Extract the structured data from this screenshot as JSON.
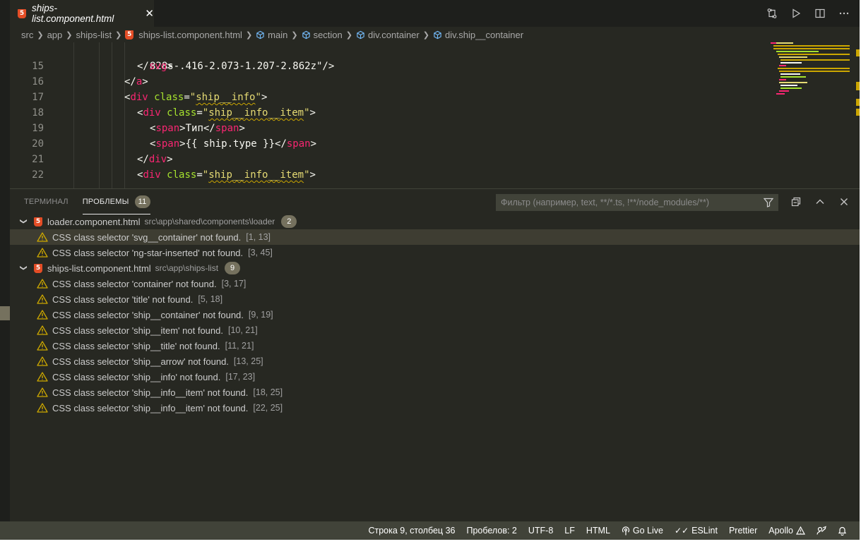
{
  "tab": {
    "title": "ships-list.component.html",
    "file_icon": "html5-icon"
  },
  "tab_actions": [
    "compare-changes-icon",
    "run-icon",
    "split-editor-icon",
    "more-actions-icon"
  ],
  "breadcrumb": [
    "src",
    "app",
    "ships-list",
    "ships-list.component.html",
    "main",
    "section",
    "div.container",
    "div.ship__container"
  ],
  "editor": {
    "first_line_text": "828s-.416-2.073-1.207-2.862z\"/>",
    "lines": [
      {
        "num": "15",
        "parts": [
          [
            "p",
            "</"
          ],
          [
            "t",
            "svg"
          ],
          [
            "p",
            ">"
          ]
        ]
      },
      {
        "num": "16",
        "parts": [
          [
            "p",
            "</"
          ],
          [
            "t",
            "a"
          ],
          [
            "p",
            ">"
          ]
        ]
      },
      {
        "num": "17",
        "parts": [
          [
            "p",
            "<"
          ],
          [
            "t",
            "div"
          ],
          [
            "p",
            " "
          ],
          [
            "a",
            "class"
          ],
          [
            "p",
            "="
          ],
          [
            "s",
            "\""
          ],
          [
            "sq",
            "ship__info"
          ],
          [
            "s",
            "\""
          ],
          [
            "p",
            ">"
          ]
        ]
      },
      {
        "num": "18",
        "parts": [
          [
            "p",
            "<"
          ],
          [
            "t",
            "div"
          ],
          [
            "p",
            " "
          ],
          [
            "a",
            "class"
          ],
          [
            "p",
            "="
          ],
          [
            "s",
            "\""
          ],
          [
            "sq",
            "ship__info__item"
          ],
          [
            "s",
            "\""
          ],
          [
            "p",
            ">"
          ]
        ]
      },
      {
        "num": "19",
        "parts": [
          [
            "p",
            "<"
          ],
          [
            "t",
            "span"
          ],
          [
            "p",
            ">Тип</"
          ],
          [
            "t",
            "span"
          ],
          [
            "p",
            ">"
          ]
        ]
      },
      {
        "num": "20",
        "parts": [
          [
            "p",
            "<"
          ],
          [
            "t",
            "span"
          ],
          [
            "p",
            ">{{ ship.type }}</"
          ],
          [
            "t",
            "span"
          ],
          [
            "p",
            ">"
          ]
        ]
      },
      {
        "num": "21",
        "parts": [
          [
            "p",
            "</"
          ],
          [
            "t",
            "div"
          ],
          [
            "p",
            ">"
          ]
        ]
      },
      {
        "num": "22",
        "parts": [
          [
            "p",
            "<"
          ],
          [
            "t",
            "div"
          ],
          [
            "p",
            " "
          ],
          [
            "a",
            "class"
          ],
          [
            "p",
            "="
          ],
          [
            "s",
            "\""
          ],
          [
            "sq",
            "ship__info__item"
          ],
          [
            "s",
            "\""
          ],
          [
            "p",
            ">"
          ]
        ]
      }
    ]
  },
  "panel": {
    "tab_terminal": "ТЕРМИНАЛ",
    "tab_problems": "ПРОБЛЕМЫ",
    "problems_count": "11",
    "filter_placeholder": "Фильтр (например, text, **/*.ts, !**/node_modules/**)",
    "actions": [
      "filter-icon",
      "collapse-all-icon",
      "maximize-panel-icon",
      "close-panel-icon"
    ]
  },
  "problems": [
    {
      "file": "loader.component.html",
      "path": "src\\app\\shared\\components\\loader",
      "count": "2",
      "items": [
        {
          "msg": "CSS class selector 'svg__container' not found.",
          "loc": "[1, 13]"
        },
        {
          "msg": "CSS class selector 'ng-star-inserted' not found.",
          "loc": "[3, 45]"
        }
      ]
    },
    {
      "file": "ships-list.component.html",
      "path": "src\\app\\ships-list",
      "count": "9",
      "items": [
        {
          "msg": "CSS class selector 'container' not found.",
          "loc": "[3, 17]"
        },
        {
          "msg": "CSS class selector 'title' not found.",
          "loc": "[5, 18]"
        },
        {
          "msg": "CSS class selector 'ship__container' not found.",
          "loc": "[9, 19]"
        },
        {
          "msg": "CSS class selector 'ship__item' not found.",
          "loc": "[10, 21]"
        },
        {
          "msg": "CSS class selector 'ship__title' not found.",
          "loc": "[11, 21]"
        },
        {
          "msg": "CSS class selector 'ship__arrow' not found.",
          "loc": "[13, 25]"
        },
        {
          "msg": "CSS class selector 'ship__info' not found.",
          "loc": "[17, 23]"
        },
        {
          "msg": "CSS class selector 'ship__info__item' not found.",
          "loc": "[18, 25]"
        },
        {
          "msg": "CSS class selector 'ship__info__item' not found.",
          "loc": "[22, 25]"
        }
      ]
    }
  ],
  "status": {
    "position": "Строка 9, столбец 36",
    "spaces": "Пробелов: 2",
    "encoding": "UTF-8",
    "eol": "LF",
    "language": "HTML",
    "golive": "Go Live",
    "eslint": "ESLint",
    "prettier": "Prettier",
    "apollo": "Apollo"
  },
  "colors": {
    "editor_bg": "#272822",
    "tag": "#f92672",
    "attr": "#a6e22e",
    "string": "#e6db74",
    "warning": "#cca700",
    "statusbar": "#414339"
  }
}
